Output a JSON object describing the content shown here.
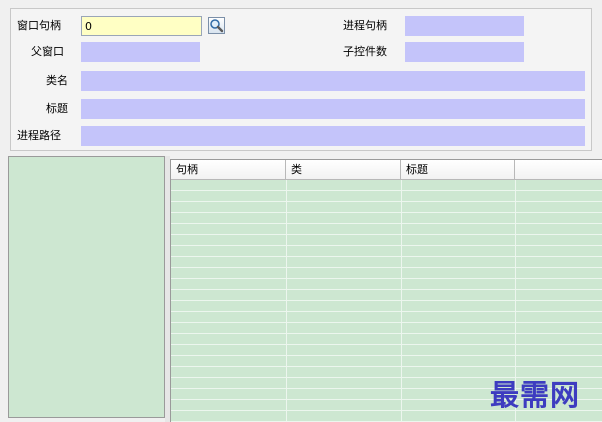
{
  "form": {
    "window_handle": {
      "label": "窗口句柄",
      "value": "0"
    },
    "parent_window": {
      "label": "父窗口",
      "value": ""
    },
    "class_name": {
      "label": "类名",
      "value": ""
    },
    "title": {
      "label": "标题",
      "value": ""
    },
    "process_path": {
      "label": "进程路径",
      "value": ""
    },
    "process_handle": {
      "label": "进程句柄",
      "value": ""
    },
    "child_control_count": {
      "label": "子控件数",
      "value": ""
    },
    "search_icon": "magnifier-icon"
  },
  "table": {
    "columns": [
      "句柄",
      "类",
      "标题",
      ""
    ],
    "rows": []
  },
  "watermark": "最需网",
  "colors": {
    "field_bg": "#c4c4fa",
    "input_bg": "#ffffc4",
    "pane_bg": "#cde7d1",
    "watermark": "#3d3cc0"
  }
}
